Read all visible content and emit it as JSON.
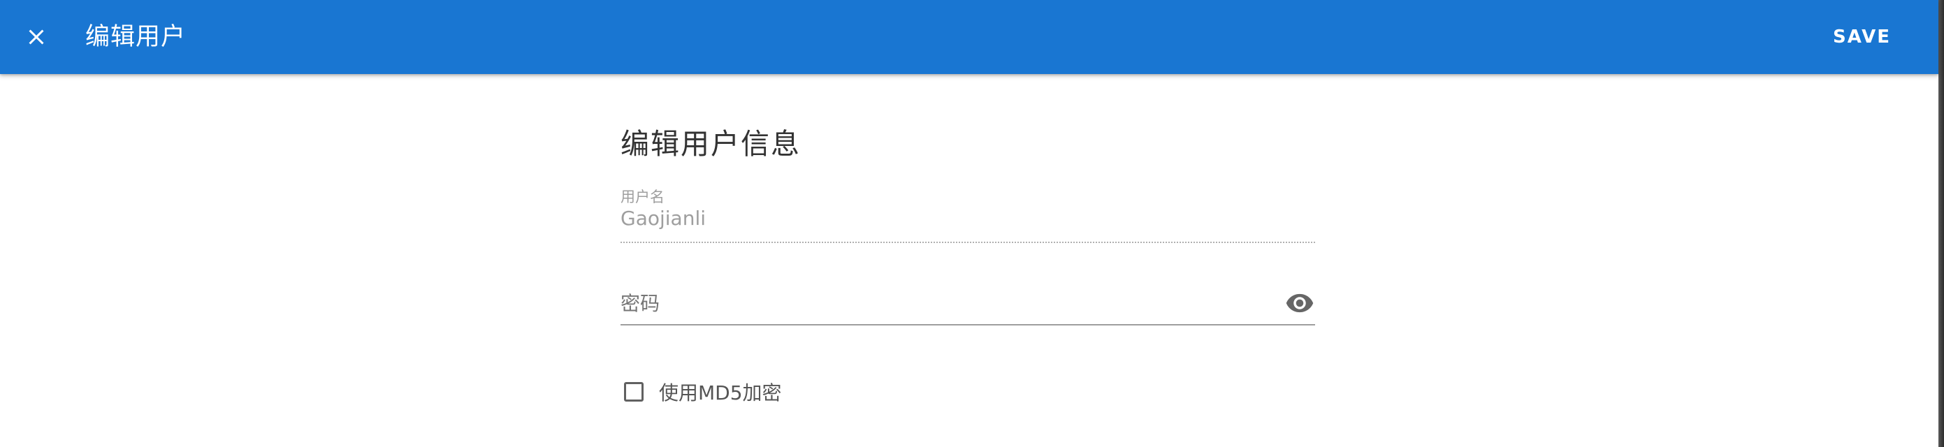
{
  "app_bar": {
    "title": "编辑用户",
    "close_icon": "close-icon",
    "save_label": "SAVE",
    "background_color": "#1976d2"
  },
  "form": {
    "heading": "编辑用户信息",
    "username": {
      "label": "用户名",
      "value": "Gaojianli"
    },
    "password": {
      "placeholder": "密码",
      "value": "",
      "visibility_icon": "eye-icon"
    },
    "md5_option": {
      "label": "使用MD5加密",
      "checked": false
    }
  }
}
